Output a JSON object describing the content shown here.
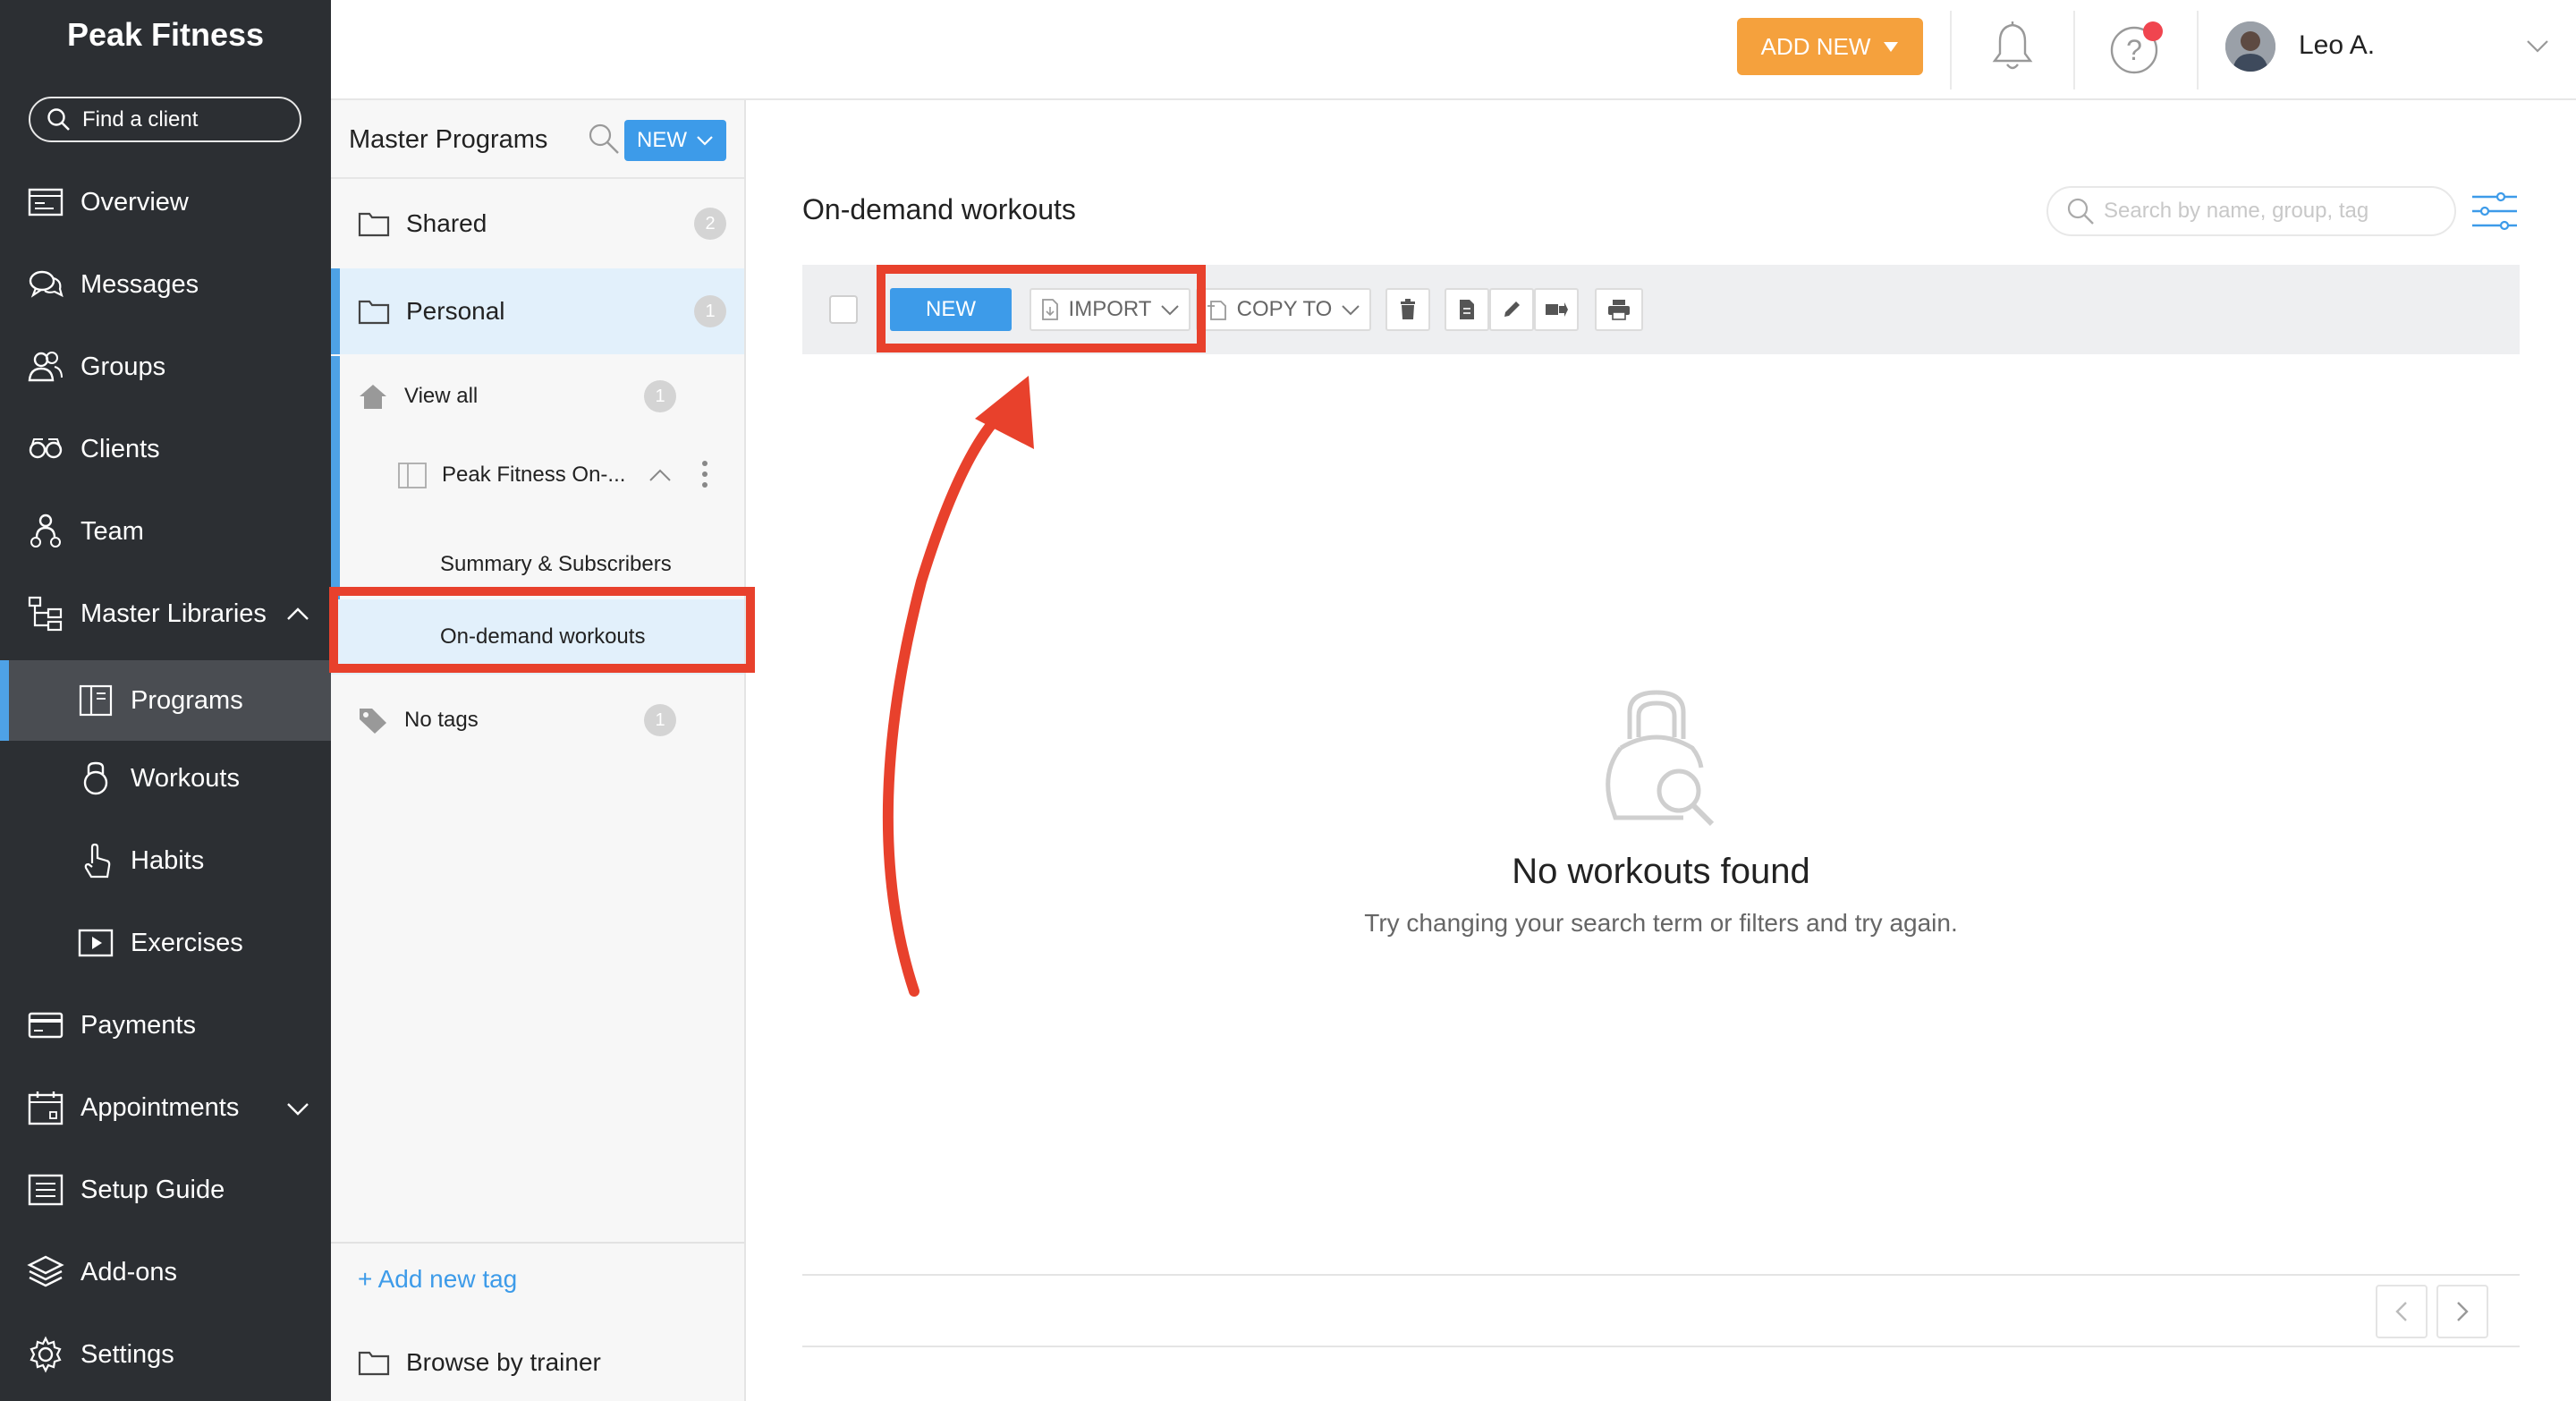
{
  "brand": "Peak Fitness",
  "find_client": "Find a client",
  "nav": {
    "overview": "Overview",
    "messages": "Messages",
    "groups": "Groups",
    "clients": "Clients",
    "team": "Team",
    "master_libraries": "Master Libraries",
    "programs": "Programs",
    "workouts": "Workouts",
    "habits": "Habits",
    "exercises": "Exercises",
    "payments": "Payments",
    "appointments": "Appointments",
    "setup_guide": "Setup Guide",
    "add_ons": "Add-ons",
    "settings": "Settings"
  },
  "header": {
    "add_new": "ADD NEW",
    "user_name": "Leo A."
  },
  "panel": {
    "title": "Master Programs",
    "new_button": "NEW",
    "shared": {
      "label": "Shared",
      "count": "2"
    },
    "personal": {
      "label": "Personal",
      "count": "1"
    },
    "view_all": {
      "label": "View all",
      "count": "1"
    },
    "program": {
      "label": "Peak Fitness On-..."
    },
    "summary": "Summary & Subscribers",
    "on_demand": "On-demand workouts",
    "no_tags": {
      "label": "No tags",
      "count": "1"
    },
    "add_tag": "+ Add new tag",
    "browse_trainer": "Browse by trainer"
  },
  "main": {
    "title": "On-demand workouts",
    "search_placeholder": "Search by name, group, tag",
    "toolbar": {
      "new": "NEW",
      "import": "IMPORT",
      "copy_to": "COPY TO"
    },
    "empty_title": "No workouts found",
    "empty_subtitle": "Try changing your search term or filters and try again."
  },
  "colors": {
    "sidebar_bg": "#2c2f33",
    "accent_blue": "#3d9be9",
    "add_new_orange": "#f5a13d",
    "highlight_red": "#e8412c",
    "notification_dot": "#f0454f"
  }
}
